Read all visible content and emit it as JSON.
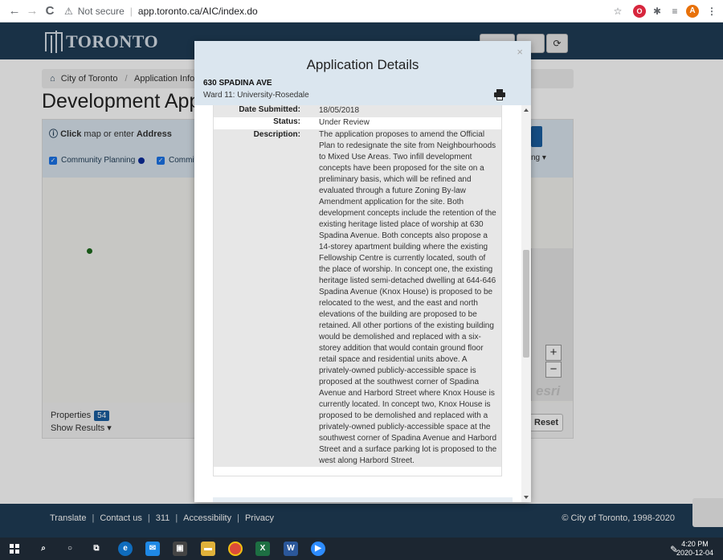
{
  "browser": {
    "back": "←",
    "forward": "→",
    "reload": "C",
    "security": "Not secure",
    "url": "app.toronto.ca/AIC/index.do",
    "profile_initial": "A"
  },
  "site": {
    "logo_text": "TORONTO",
    "breadcrumb": [
      "City of Toronto",
      "Application Informati"
    ],
    "page_title": "Development App",
    "click_hint_bold": "Click",
    "click_hint_mid": " map or enter ",
    "click_hint_end": "Address",
    "layer_1": "Community Planning",
    "layer_2": "Commit",
    "right_mini": "ng ▾",
    "properties_label": "Properties",
    "properties_count": "54",
    "show_results": "Show Results ▾",
    "reset": "Reset",
    "esri": "esri",
    "zoom_in": "+",
    "zoom_out": "−"
  },
  "modal": {
    "title": "Application Details",
    "close": "×",
    "address": "630 SPADINA AVE",
    "ward": "Ward 11: University-Rosedale",
    "date_submitted_label": "Date Submitted:",
    "date_submitted": "18/05/2018",
    "status_label": "Status:",
    "status": "Under Review",
    "description_label": "Description:",
    "description": "The application proposes to amend the Official Plan to redesignate the site from Neighbourhoods to Mixed Use Areas. Two infill development concepts have been proposed for the site on a preliminary basis, which will be refined and evaluated through a future Zoning By-law Amendment application for the site. Both development concepts include the retention of the existing heritage listed place of worship at 630 Spadina Avenue. Both concepts also propose a 14-storey apartment building where the existing Fellowship Centre is currently located, south of the place of worship. In concept one, the existing heritage listed semi-detached dwelling at 644-646 Spadina Avenue (Knox House) is proposed to be relocated to the west, and the east and north elevations of the building are proposed to be retained. All other portions of the existing building would be demolished and replaced with a six-storey addition that would contain ground floor retail space and residential units above. A privately-owned publicly-accessible space is proposed at the southwest corner of Spadina Avenue and Harbord Street where Knox House is currently located. In concept two, Knox House is proposed to be demolished and replaced with a privately-owned publicly-accessible space at the southwest corner of Spadina Avenue and Harbord Street and a surface parking lot is proposed to the west along Harbord Street."
  },
  "footer": {
    "links": [
      "Translate",
      "Contact us",
      "311",
      "Accessibility",
      "Privacy"
    ],
    "copyright": "© City of Toronto, 1998-2020"
  },
  "taskbar": {
    "time": "4:20 PM",
    "date": "2020-12-04"
  },
  "colors": {
    "header_navy": "#1f3c56",
    "modal_header": "#dbe6ef",
    "accent_blue": "#1a5fa0"
  }
}
